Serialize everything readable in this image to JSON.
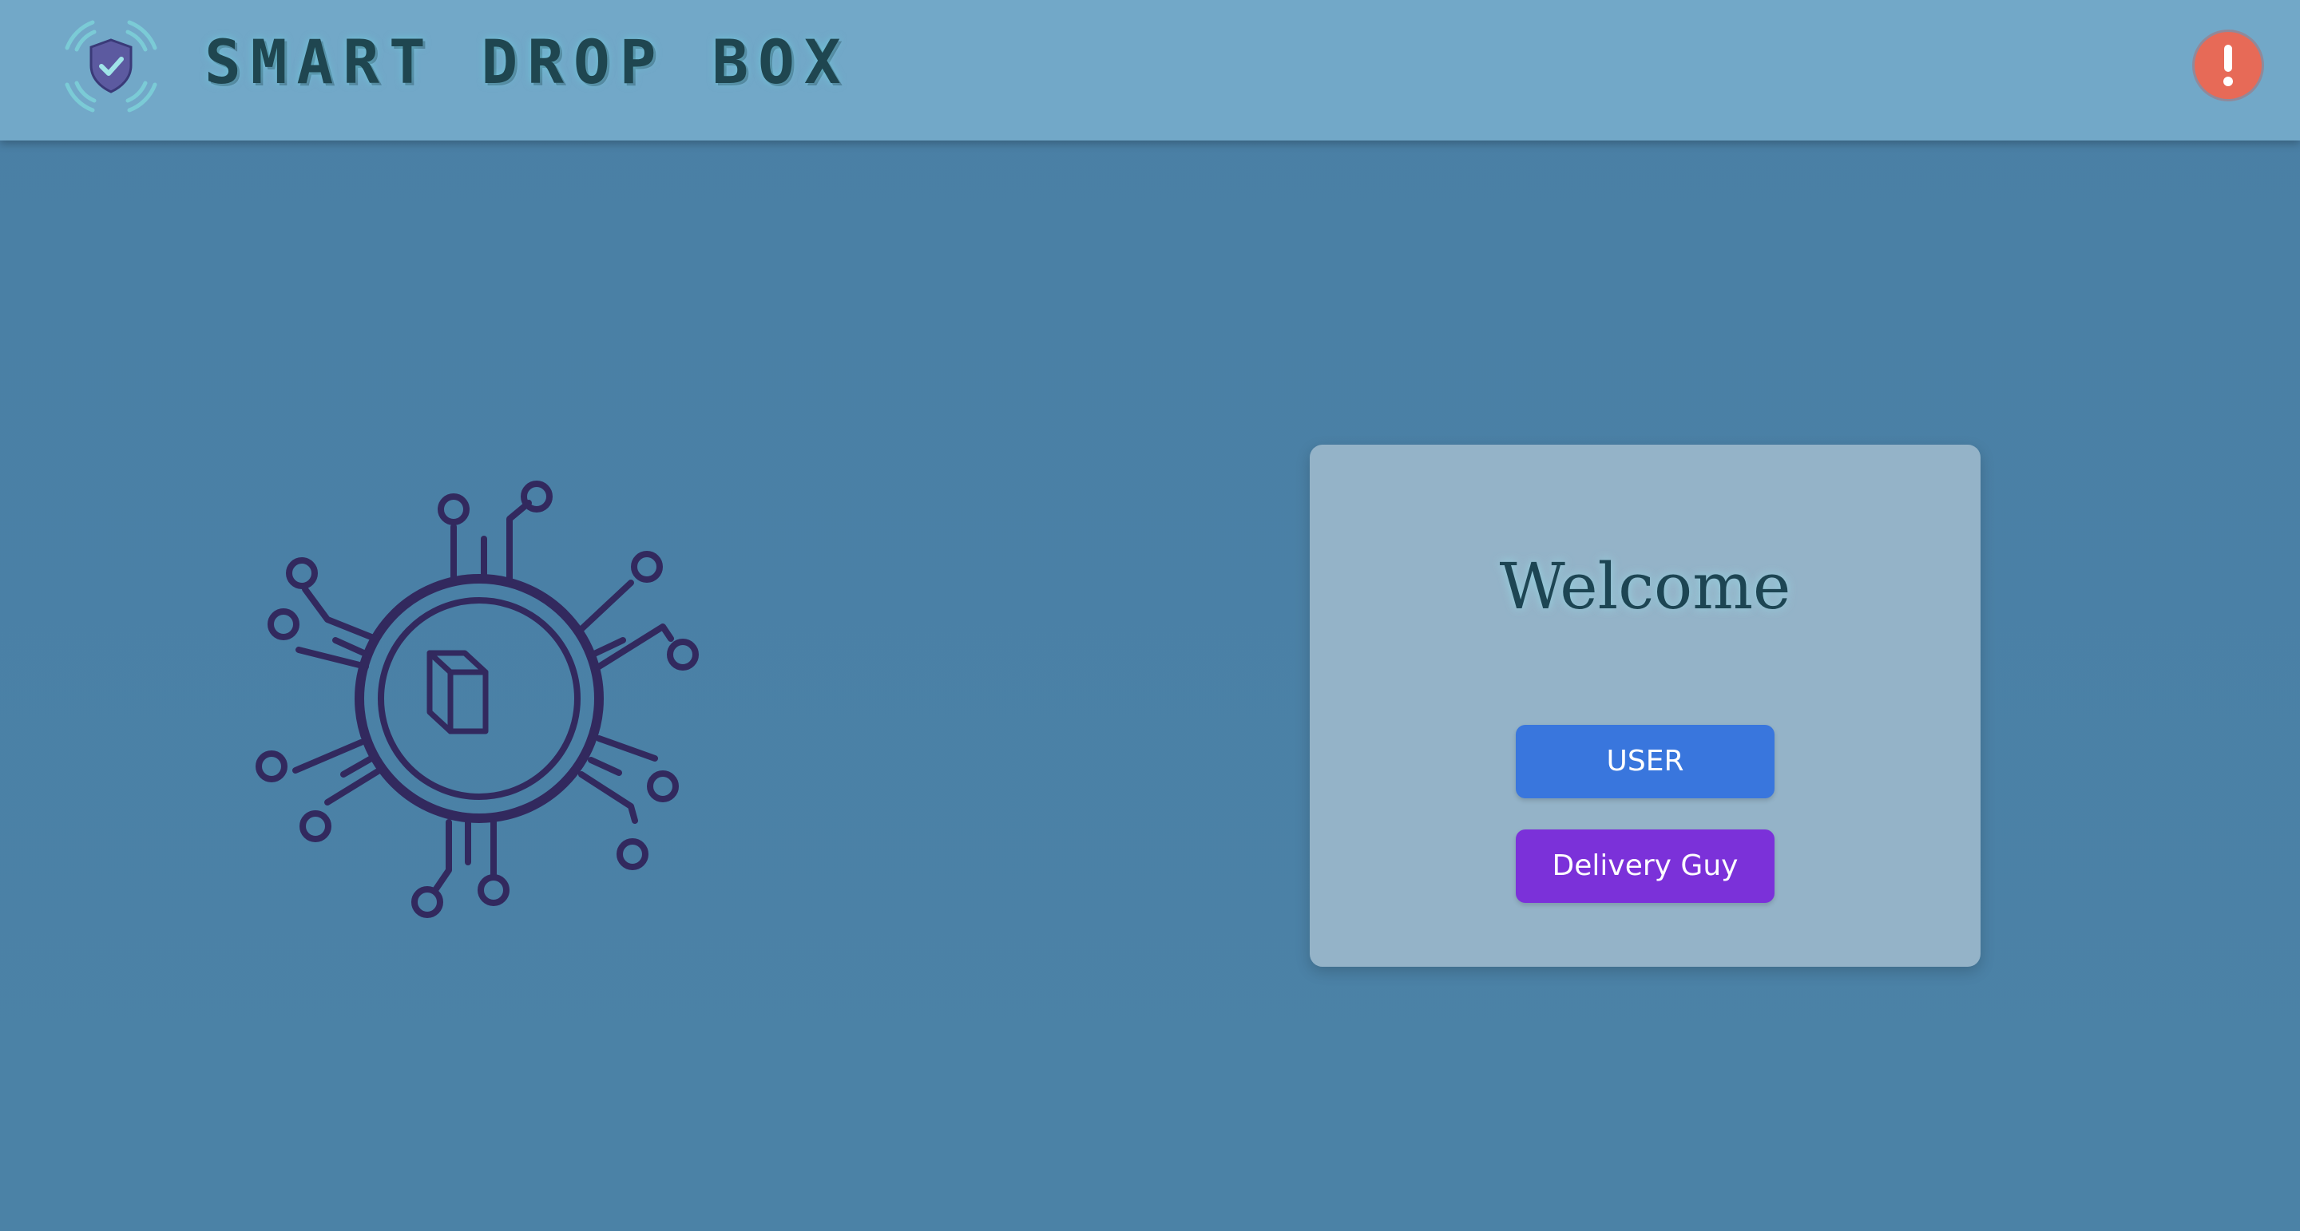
{
  "header": {
    "brand": "SMART DROP BOX",
    "logo_icon": "shield-scan-icon",
    "alert_icon": "exclamation-alert-icon"
  },
  "hero": {
    "icon": "circuit-box-icon"
  },
  "card": {
    "title": "Welcome",
    "user_button": "USER",
    "delivery_button": "Delivery Guy"
  },
  "colors": {
    "background": "#4a7fa5",
    "header": "#72a8c8",
    "brand_text": "#1f4650",
    "card": "#94b3c8",
    "user_button": "#3976dd",
    "delivery_button": "#7b31d9",
    "alert": "#e76a57",
    "hero_stroke": "#32295e"
  }
}
